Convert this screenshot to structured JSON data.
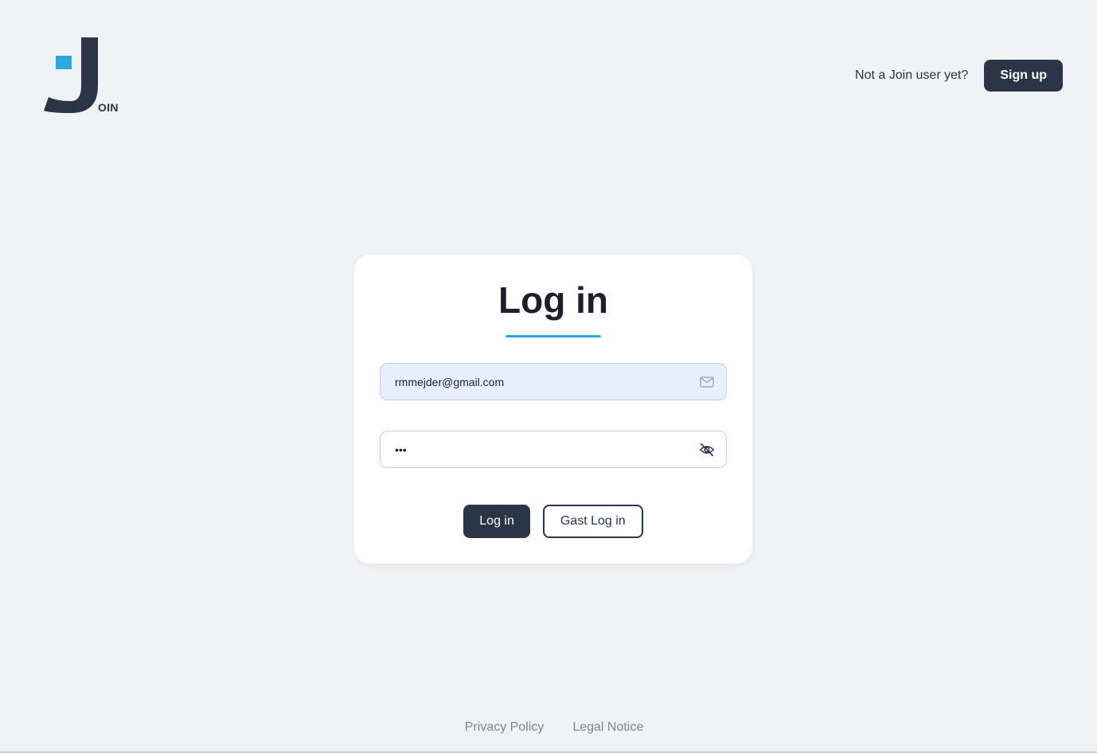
{
  "logo": {
    "text": "OIN",
    "colors": {
      "dark": "#2a3647",
      "accent": "#29abe2"
    }
  },
  "header": {
    "prompt_text": "Not a Join user yet?",
    "signup_label": "Sign up"
  },
  "login_card": {
    "title": "Log in",
    "email": {
      "value": "rmmejder@gmail.com",
      "icon": "mail-icon"
    },
    "password": {
      "value": "123",
      "icon": "eye-off-icon"
    },
    "login_button_label": "Log in",
    "guest_button_label": "Gast Log in"
  },
  "footer": {
    "privacy_label": "Privacy Policy",
    "legal_label": "Legal Notice"
  },
  "colors": {
    "background": "#f0f2f5",
    "primary": "#2a3647",
    "accent": "#29abe2",
    "email_field_bg": "#e8f0fe",
    "footer_link": "#7d8591"
  }
}
